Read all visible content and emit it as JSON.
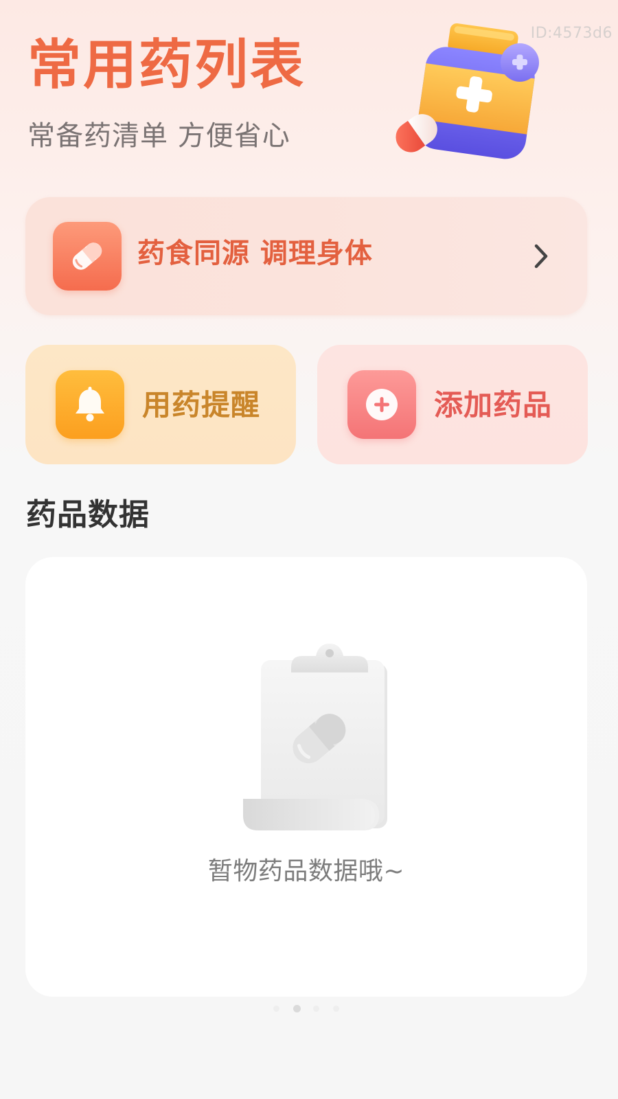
{
  "watermark": "ID:4573d6",
  "header": {
    "title": "常用药列表",
    "subtitle": "常备药清单 方便省心",
    "illustration_icon": "medicine-bottle-icon"
  },
  "banner": {
    "label": "药食同源 调理身体",
    "icon": "pill-icon",
    "chevron_icon": "chevron-right-icon"
  },
  "quick_actions": [
    {
      "label": "用药提醒",
      "icon": "bell-icon",
      "color": "#fc9f1f"
    },
    {
      "label": "添加药品",
      "icon": "plus-circle-icon",
      "color": "#f47476"
    }
  ],
  "section": {
    "title": "药品数据"
  },
  "empty_state": {
    "icon": "clipboard-pill-icon",
    "text": "暂物药品数据哦~"
  },
  "pager": {
    "count": 4,
    "active_index": 1
  },
  "colors": {
    "accent": "#ee6a44",
    "subtitle": "#7a7373",
    "reminder_bg": "#fde7c6",
    "add_bg": "#fde4e1"
  }
}
